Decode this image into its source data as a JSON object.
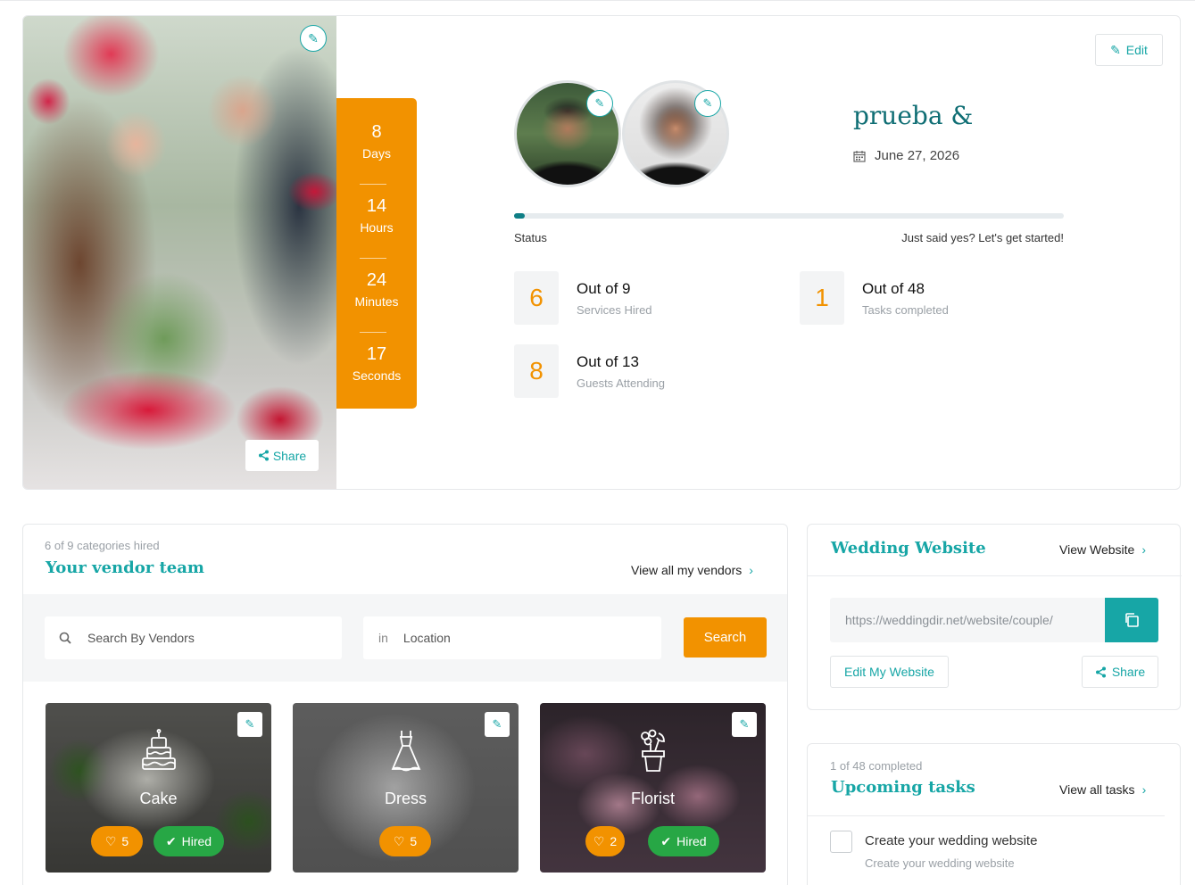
{
  "hero": {
    "share_label": "Share",
    "edit_label": "Edit",
    "countdown": [
      {
        "value": "8",
        "unit": "Days"
      },
      {
        "value": "14",
        "unit": "Hours"
      },
      {
        "value": "24",
        "unit": "Minutes"
      },
      {
        "value": "17",
        "unit": "Seconds"
      }
    ],
    "couple_name": "prueba &",
    "date": "June 27, 2026",
    "progress": 0.02,
    "status_label": "Status",
    "status_message": "Just said yes? Let's get started!",
    "stats": [
      {
        "value": "6",
        "title": "Out of 9",
        "subtitle": "Services Hired"
      },
      {
        "value": "1",
        "title": "Out of 48",
        "subtitle": "Tasks completed"
      },
      {
        "value": "8",
        "title": "Out of 13",
        "subtitle": "Guests Attending"
      }
    ]
  },
  "vendors": {
    "meta": "6 of 9 categories hired",
    "title": "Your vendor team",
    "view_all": "View all my vendors",
    "search": {
      "vendor_placeholder": "Search By Vendors",
      "in_label": "in",
      "location_placeholder": "Location",
      "button": "Search"
    },
    "cards": [
      {
        "name": "Cake",
        "likes": "5",
        "hired_label": "Hired",
        "icon": "cake-icon"
      },
      {
        "name": "Dress",
        "likes": "5",
        "icon": "dress-icon"
      },
      {
        "name": "Florist",
        "likes": "2",
        "hired_label": "Hired",
        "icon": "flower-pot-icon"
      }
    ]
  },
  "website": {
    "title": "Wedding Website",
    "view_link": "View Website",
    "url": "https://weddingdir.net/website/couple/",
    "edit_label": "Edit My Website",
    "share_label": "Share"
  },
  "tasks": {
    "meta": "1 of 48 completed",
    "title": "Upcoming tasks",
    "view_link": "View all tasks",
    "items": [
      {
        "title": "Create your wedding website",
        "subtitle": "Create your wedding website"
      }
    ]
  },
  "colors": {
    "accent_teal": "#17a6a6",
    "accent_orange": "#f29200",
    "hired_green": "#27a745"
  }
}
